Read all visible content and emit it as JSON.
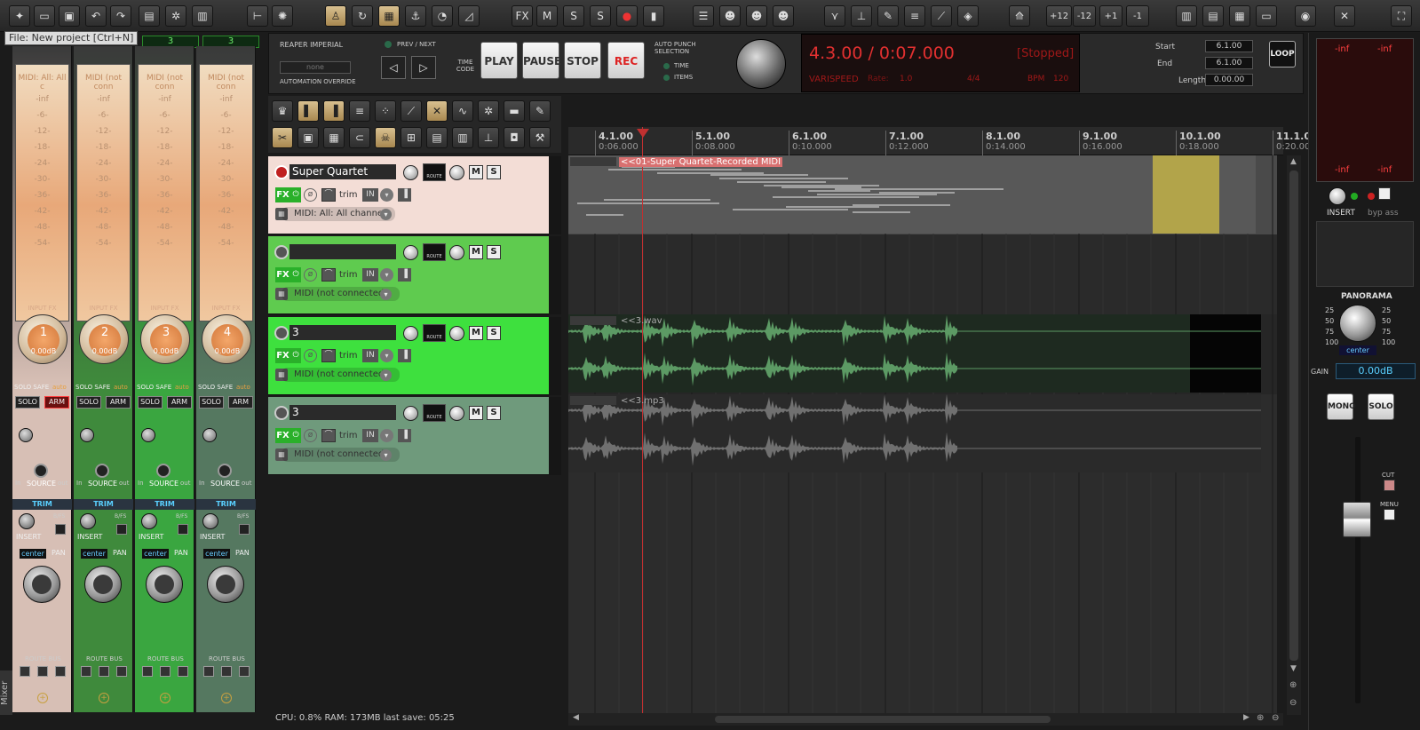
{
  "tooltip": "File: New project [Ctrl+N]",
  "toolbar": {
    "right_buttons": [
      "+12",
      "-12",
      "+1",
      "-1"
    ]
  },
  "mixer": {
    "header_values": [
      "3",
      "3"
    ],
    "strips": [
      {
        "number": "1",
        "db": "0.00dB",
        "midi": "MIDI: All: All c",
        "arm": "ARM",
        "solo": "SOLO",
        "pan": "center",
        "color": "#d7bfb5"
      },
      {
        "number": "2",
        "db": "0.00dB",
        "midi": "MIDI (not conn",
        "arm": "ARM",
        "solo": "SOLO",
        "pan": "center",
        "color": "#3f8a3c"
      },
      {
        "number": "3",
        "db": "0.00dB",
        "midi": "MIDI (not conn",
        "arm": "ARM",
        "solo": "SOLO",
        "pan": "center",
        "color": "#3aa640"
      },
      {
        "number": "4",
        "db": "0.00dB",
        "midi": "MIDI (not conn",
        "arm": "ARM",
        "solo": "SOLO",
        "pan": "center",
        "color": "#557860"
      }
    ],
    "meter_scale": [
      "-inf",
      "-6-",
      "-12-",
      "-18-",
      "-24-",
      "-30-",
      "-36-",
      "-42-",
      "-48-",
      "-54-"
    ],
    "solo_safe": "SOLO SAFE",
    "auto": "auto",
    "source": "SOURCE",
    "in": "In",
    "out": "out",
    "trim": "TRIM",
    "insert": "INSERT",
    "bfs": "B/FS",
    "pan_label": "PAN",
    "route_bus": "ROUTE BUS",
    "input_fx": "INPUT FX",
    "mixer_tab": "Mixer"
  },
  "transport": {
    "brand": "REAPER IMPERIAL",
    "prev_next": "PREV / NEXT",
    "preset": "none",
    "automation_override": "AUTOMATION OVERRIDE",
    "time_code": "TIME CODE",
    "play": "PLAY",
    "pause": "PAUSE",
    "stop": "STOP",
    "rec": "REC",
    "auto_punch": "AUTO PUNCH SELECTION",
    "time": "TIME",
    "items": "ITEMS",
    "position": "4.3.00 / 0:07.000",
    "state": "[Stopped]",
    "varispeed": "VARISPEED",
    "rate_label": "Rate:",
    "rate": "1.0",
    "signature": "4/4",
    "bpm_label": "BPM",
    "bpm": "120",
    "start_label": "Start",
    "start": "6.1.00",
    "end_label": "End",
    "end": "6.1.00",
    "length_label": "Length",
    "length": "0.00.00",
    "loop": "LOOP"
  },
  "tracks": [
    {
      "name": "Super Quartet",
      "midi": "MIDI: All: All channe",
      "bg": "#f3ddd6",
      "fx": "FX",
      "trim": "trim",
      "in": "IN",
      "route": "ROUTE",
      "m": "M",
      "s": "S"
    },
    {
      "name": "",
      "midi": "MIDI (not connected)",
      "bg": "#5fcb4f",
      "fx": "FX",
      "trim": "trim",
      "in": "IN",
      "route": "ROUTE",
      "m": "M",
      "s": "S"
    },
    {
      "name": "3",
      "midi": "MIDI (not connected)",
      "bg": "#3ee03e",
      "fx": "FX",
      "trim": "trim",
      "in": "IN",
      "route": "ROUTE",
      "m": "M",
      "s": "S"
    },
    {
      "name": "3",
      "midi": "MIDI (not connected)",
      "bg": "#6f9a7c",
      "fx": "FX",
      "trim": "trim",
      "in": "IN",
      "route": "ROUTE",
      "m": "M",
      "s": "S"
    }
  ],
  "ruler": [
    {
      "bar": "4.1.00",
      "time": "0:06.000"
    },
    {
      "bar": "5.1.00",
      "time": "0:08.000"
    },
    {
      "bar": "6.1.00",
      "time": "0:10.000"
    },
    {
      "bar": "7.1.00",
      "time": "0:12.000"
    },
    {
      "bar": "8.1.00",
      "time": "0:14.000"
    },
    {
      "bar": "9.1.00",
      "time": "0:16.000"
    },
    {
      "bar": "10.1.00",
      "time": "0:18.000"
    },
    {
      "bar": "11.1.00",
      "time": "0:20.000"
    }
  ],
  "items": {
    "midi_item": "<<01-Super Quartet-Recorded MIDI",
    "wav_item": "<<3.wav",
    "mp3_item": "<<3.mp3"
  },
  "master": {
    "inf_left": "-inf",
    "inf_right": "-inf",
    "insert": "INSERT",
    "bypass": "byp ass",
    "panorama": "PANORAMA",
    "pan_value": "center",
    "gain_label": "GAIN",
    "gain": "0.00dB",
    "mono": "MONO",
    "solo": "SOLO",
    "cut": "CUT",
    "menu": "MENU",
    "pan_left": [
      "25",
      "50",
      "75",
      "100"
    ],
    "pan_right": [
      "25",
      "50",
      "75",
      "100"
    ]
  },
  "status": "CPU: 0.8%   RAM: 173MB   last save: 05:25"
}
